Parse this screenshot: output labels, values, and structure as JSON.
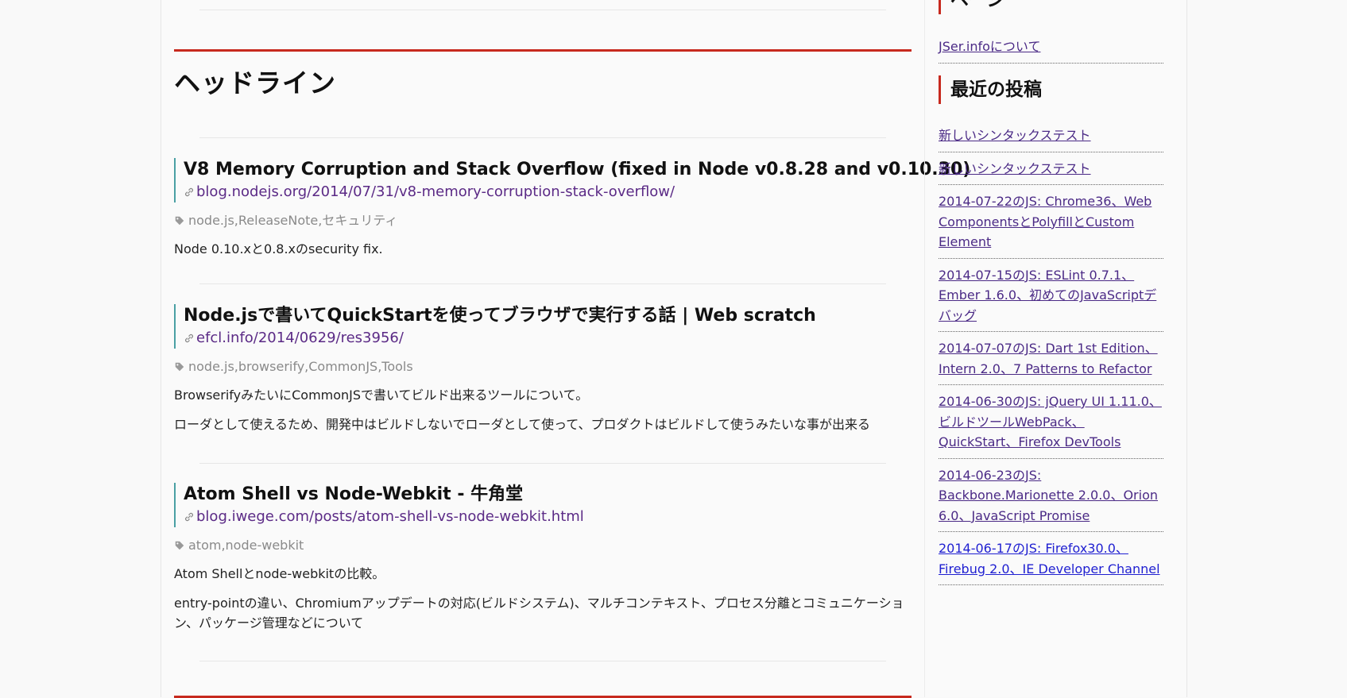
{
  "headline_section": {
    "title": "ヘッドライン"
  },
  "entries": [
    {
      "title": "V8 Memory Corruption and Stack Overflow (fixed in Node v0.8.28 and v0.10.30)",
      "url": "blog.nodejs.org/2014/07/31/v8-memory-corruption-stack-overflow/",
      "tags": "node.js,ReleaseNote,セキュリティ",
      "descriptions": [
        "Node 0.10.xと0.8.xのsecurity fix."
      ]
    },
    {
      "title": "Node.jsで書いてQuickStartを使ってブラウザで実行する話 | Web scratch",
      "url": "efcl.info/2014/0629/res3956/",
      "tags": "node.js,browserify,CommonJS,Tools",
      "descriptions": [
        "BrowserifyみたいにCommonJSで書いてビルド出来るツールについて。",
        "ローダとして使えるため、開発中はビルドしないでローダとして使って、プロダクトはビルドして使うみたいな事が出来る"
      ]
    },
    {
      "title": "Atom Shell vs Node-Webkit - 牛角堂",
      "url": "blog.iwege.com/posts/atom-shell-vs-node-webkit.html",
      "tags": "atom,node-webkit",
      "descriptions": [
        "Atom Shellとnode-webkitの比較。",
        "entry-pointの違い、Chromiumアップデートの対応(ビルドシステム)、マルチコンテキスト、プロセス分離とコミュニケーション、パッケージ管理などについて"
      ]
    }
  ],
  "sidebar": {
    "pages_heading": "ページ",
    "pages": [
      "JSer.infoについて"
    ],
    "recent_heading": "最近の投稿",
    "recent_posts": [
      "新しいシンタックステスト",
      "新しいシンタックステスト",
      "2014-07-22のJS: Chrome36、Web ComponentsとPolyfillとCustom Element",
      "2014-07-15のJS: ESLint 0.7.1、Ember 1.6.0、初めてのJavaScriptデバッグ",
      "2014-07-07のJS: Dart 1st Edition、Intern 2.0、7 Patterns to Refactor",
      "2014-06-30のJS: jQuery UI 1.11.0、ビルドツールWebPack、QuickStart、Firefox DevTools",
      "2014-06-23のJS: Backbone.Marionette 2.0.0、Orion 6.0、JavaScript Promise",
      "2014-06-17のJS: Firefox30.0、Firebug 2.0、IE Developer Channel"
    ]
  },
  "icons": {
    "link": "link-icon",
    "tag": "tag-icon"
  },
  "colors": {
    "accent_red": "#c7291e",
    "link_visited": "#5b2a86",
    "link_unvisited": "#1f1fd1",
    "entry_bar": "#4aa0a4"
  }
}
